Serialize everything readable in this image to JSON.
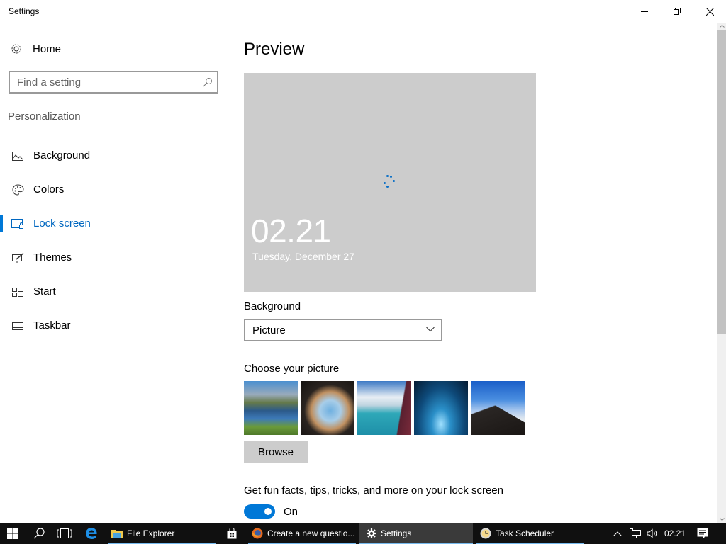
{
  "window": {
    "title": "Settings",
    "controls": {
      "minimize": "minimize-icon",
      "restore": "restore-icon",
      "close": "close-icon"
    }
  },
  "sidebar": {
    "home_label": "Home",
    "search": {
      "placeholder": "Find a setting",
      "value": ""
    },
    "section_label": "Personalization",
    "items": [
      {
        "label": "Background",
        "icon": "picture-icon",
        "active": false
      },
      {
        "label": "Colors",
        "icon": "palette-icon",
        "active": false
      },
      {
        "label": "Lock screen",
        "icon": "lock-screen-icon",
        "active": true
      },
      {
        "label": "Themes",
        "icon": "themes-icon",
        "active": false
      },
      {
        "label": "Start",
        "icon": "start-icon",
        "active": false
      },
      {
        "label": "Taskbar",
        "icon": "taskbar-icon",
        "active": false
      }
    ]
  },
  "main": {
    "title": "Preview",
    "preview": {
      "time": "02.21",
      "date": "Tuesday, December 27"
    },
    "background_label": "Background",
    "background_value": "Picture",
    "choose_label": "Choose your picture",
    "pictures": [
      "Lake between mountains",
      "Beach seen from cave",
      "Aerial view of sea and clouds",
      "Blue ice cave",
      "Hill above clouds"
    ],
    "browse_label": "Browse",
    "tips_label": "Get fun facts, tips, tricks, and more on your lock screen",
    "tips_toggle": {
      "on": true,
      "state_label": "On"
    },
    "accent_color": "#0078d7"
  },
  "taskbar": {
    "apps": [
      {
        "label": "File Explorer",
        "icon": "folder-icon",
        "active": false
      },
      {
        "label": "Create a new questio...",
        "icon": "firefox-icon",
        "active": false
      },
      {
        "label": "Settings",
        "icon": "gear-icon",
        "active": true
      },
      {
        "label": "Task Scheduler",
        "icon": "clock-icon",
        "active": false
      }
    ],
    "time": "02.21"
  }
}
